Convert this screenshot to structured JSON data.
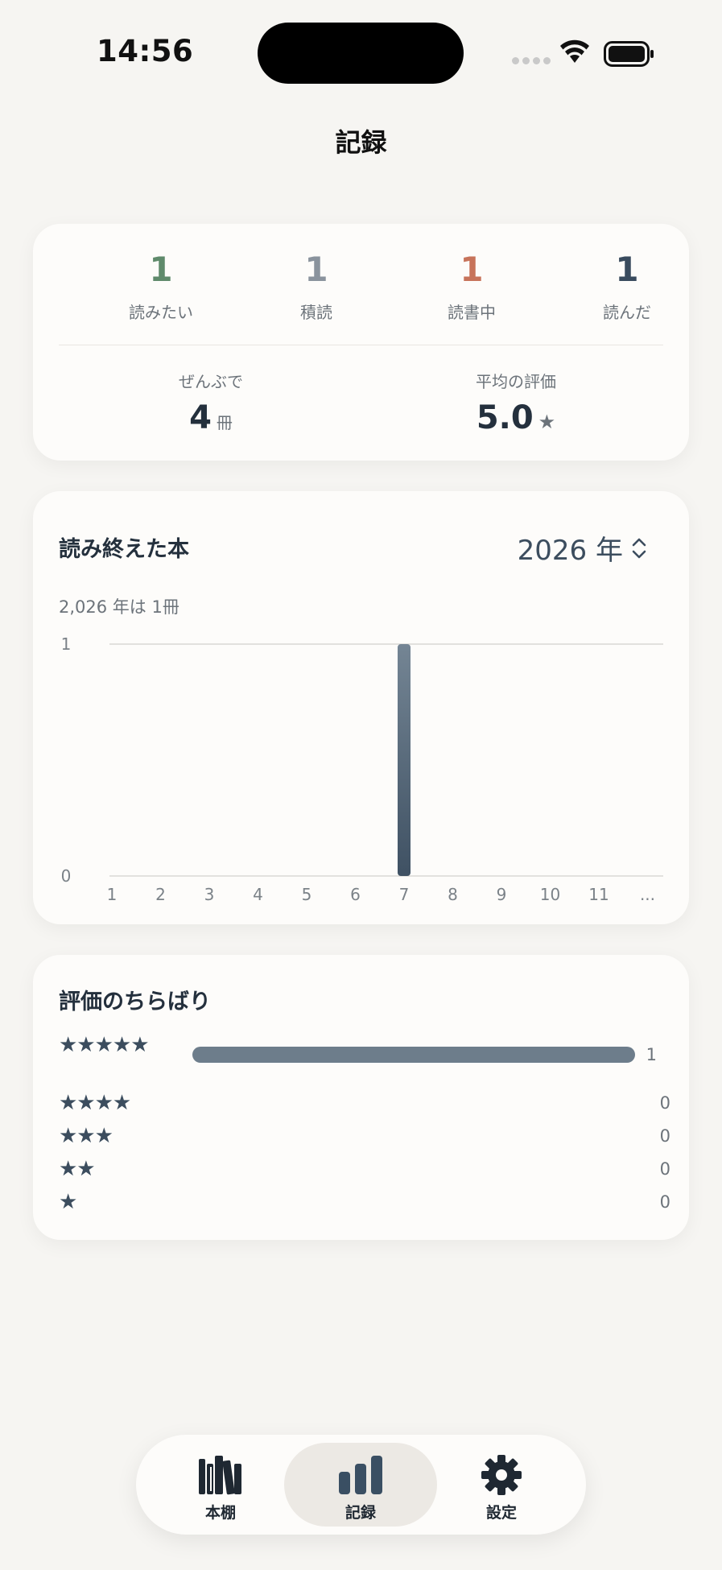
{
  "status_bar": {
    "time": "14:56"
  },
  "header": {
    "title": "記録"
  },
  "summary": {
    "statuses": [
      {
        "count": "1",
        "label": "読みたい",
        "color": "#5f8a6b"
      },
      {
        "count": "1",
        "label": "積読",
        "color": "#8a939d"
      },
      {
        "count": "1",
        "label": "読書中",
        "color": "#c7735a"
      },
      {
        "count": "1",
        "label": "読んだ",
        "color": "#394b5e"
      }
    ],
    "total": {
      "label": "ぜんぶで",
      "value": "4",
      "unit": "冊"
    },
    "average": {
      "label": "平均の評価",
      "value": "5.0",
      "icon": "star-icon",
      "star": "★"
    }
  },
  "finished_chart": {
    "title": "読み終えた本",
    "year_label": "2026 年",
    "summary": "2,026 年は 1冊",
    "chart_data": {
      "type": "bar",
      "categories": [
        "1",
        "2",
        "3",
        "4",
        "5",
        "6",
        "7",
        "8",
        "9",
        "10",
        "11",
        "..."
      ],
      "values": [
        0,
        0,
        0,
        0,
        0,
        0,
        1,
        0,
        0,
        0,
        0,
        0
      ],
      "ylim": [
        0,
        1
      ],
      "yticks": [
        "0",
        "1"
      ],
      "bar_color": "#3f5163",
      "grid": true
    }
  },
  "rating_distribution": {
    "title": "評価のちらばり",
    "rows": [
      {
        "stars": "★★★★★",
        "count": "1",
        "fraction": 1.0
      },
      {
        "stars": "★★★★",
        "count": "0",
        "fraction": 0
      },
      {
        "stars": "★★★",
        "count": "0",
        "fraction": 0
      },
      {
        "stars": "★★",
        "count": "0",
        "fraction": 0
      },
      {
        "stars": "★",
        "count": "0",
        "fraction": 0
      }
    ]
  },
  "tabbar": {
    "tabs": [
      {
        "label": "本棚",
        "icon": "bookshelf-icon"
      },
      {
        "label": "記録",
        "icon": "bar-chart-icon",
        "active": true
      },
      {
        "label": "設定",
        "icon": "gear-icon"
      }
    ]
  }
}
